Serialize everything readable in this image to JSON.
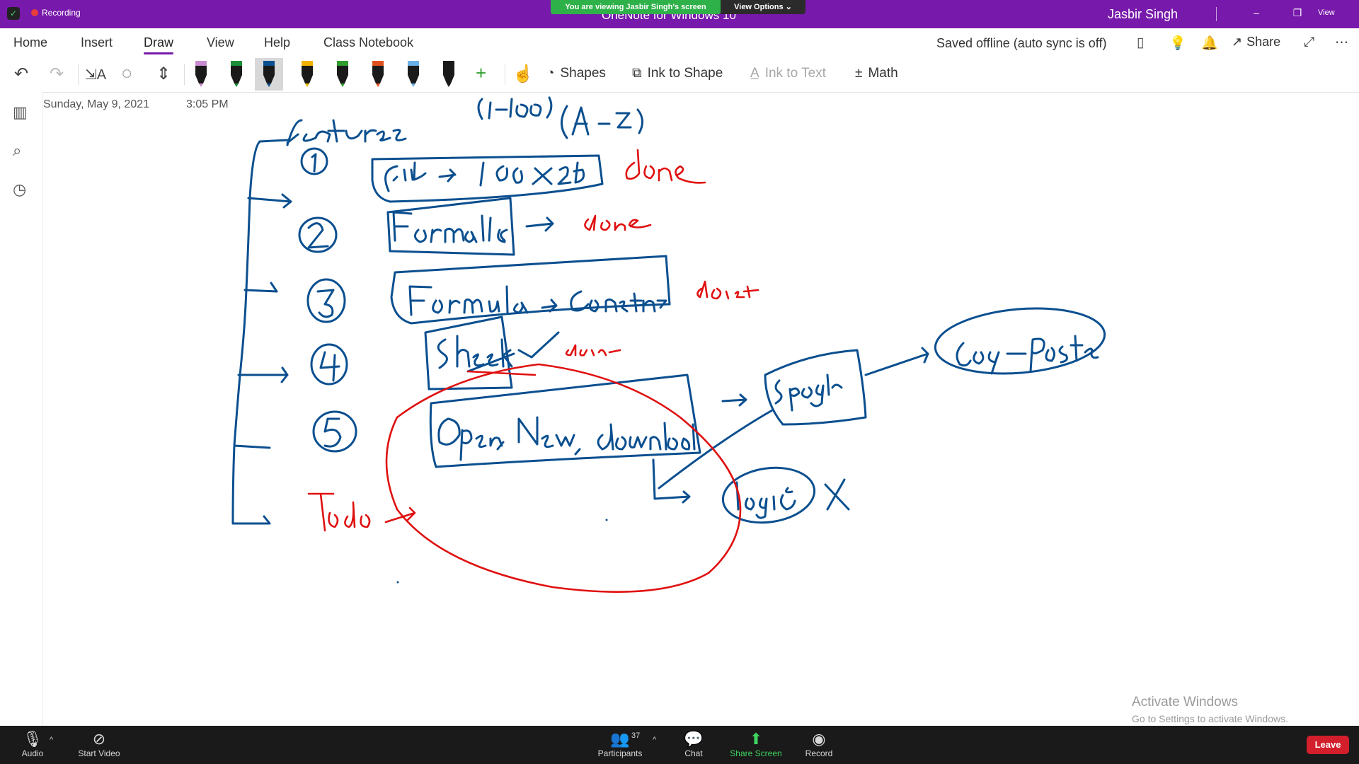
{
  "titlebar": {
    "recording_label": "Recording",
    "app_title": "OneNote for Windows 10",
    "viewing_banner": "You are viewing Jasbir Singh's screen",
    "view_options": "View Options ⌄",
    "user_name": "Jasbir Singh",
    "view_mini": "View"
  },
  "tabs": [
    {
      "label": "Home"
    },
    {
      "label": "Insert"
    },
    {
      "label": "Draw"
    },
    {
      "label": "View"
    },
    {
      "label": "Help"
    },
    {
      "label": "Class Notebook"
    }
  ],
  "active_tab": "Draw",
  "sync_status": "Saved offline (auto sync is off)",
  "share_label": "Share",
  "toolbar": {
    "shapes_label": "Shapes",
    "ink_to_shape_label": "Ink to Shape",
    "ink_to_text_label": "Ink to Text",
    "math_label": "Math",
    "pens": [
      {
        "color": "#1a1a1a",
        "tip": "#c98bd0"
      },
      {
        "color": "#1a1a1a",
        "tip": "#1b8f3a"
      },
      {
        "color": "#1a1a1a",
        "tip": "#0b4f8f"
      },
      {
        "color": "#1a1a1a",
        "tip": "#f0b400"
      },
      {
        "color": "#1a1a1a",
        "tip": "#2f9e2f"
      },
      {
        "color": "#1a1a1a",
        "tip": "#e0521d"
      },
      {
        "color": "#1a1a1a",
        "tip": "#6ab0e8"
      },
      {
        "color": "#1a1a1a",
        "tip": "#1a1a1a"
      }
    ]
  },
  "page": {
    "date": "Sunday, May 9, 2021",
    "time": "3:05 PM"
  },
  "ink_colors": {
    "blue": "#0b4f8f",
    "red": "#e01010"
  },
  "watermark": {
    "line1": "Activate Windows",
    "line2": "Go to Settings to activate Windows."
  },
  "zoom": {
    "audio": "Audio",
    "start_video": "Start Video",
    "participants": "Participants",
    "participants_count": "37",
    "chat": "Chat",
    "share_screen": "Share Screen",
    "record": "Record",
    "leave": "Leave"
  }
}
